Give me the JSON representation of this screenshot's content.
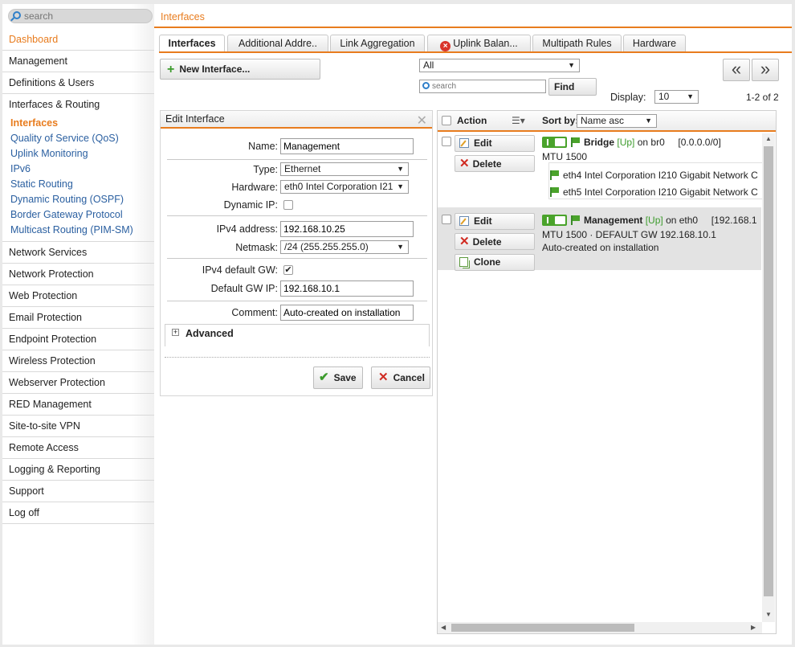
{
  "sidebar": {
    "search_placeholder": "search",
    "items_top": [
      {
        "label": "Dashboard",
        "active": true
      },
      {
        "label": "Management"
      },
      {
        "label": "Definitions & Users"
      }
    ],
    "open_section": "Interfaces & Routing",
    "subitems": [
      {
        "label": "Interfaces",
        "active": true
      },
      {
        "label": "Quality of Service (QoS)"
      },
      {
        "label": "Uplink Monitoring"
      },
      {
        "label": "IPv6"
      },
      {
        "label": "Static Routing"
      },
      {
        "label": "Dynamic Routing (OSPF)"
      },
      {
        "label": "Border Gateway Protocol"
      },
      {
        "label": "Multicast Routing (PIM-SM)"
      }
    ],
    "items_bottom": [
      {
        "label": "Network Services"
      },
      {
        "label": "Network Protection"
      },
      {
        "label": "Web Protection"
      },
      {
        "label": "Email Protection"
      },
      {
        "label": "Endpoint Protection"
      },
      {
        "label": "Wireless Protection"
      },
      {
        "label": "Webserver Protection"
      },
      {
        "label": "RED Management"
      },
      {
        "label": "Site-to-site VPN"
      },
      {
        "label": "Remote Access"
      },
      {
        "label": "Logging & Reporting"
      },
      {
        "label": "Support"
      },
      {
        "label": "Log off"
      }
    ]
  },
  "breadcrumb": "Interfaces",
  "tabs": [
    {
      "label": "Interfaces",
      "active": true
    },
    {
      "label": "Additional Addre.."
    },
    {
      "label": "Link Aggregation"
    },
    {
      "label": "Uplink Balan...",
      "error": true
    },
    {
      "label": "Multipath Rules"
    },
    {
      "label": "Hardware"
    }
  ],
  "toolbar": {
    "new_button": "New Interface...",
    "filter_value": "All",
    "search_placeholder": "search",
    "find_button": "Find",
    "prev_button": "«",
    "next_button": "»",
    "display_label": "Display:",
    "display_value": "10",
    "count": "1-2 of 2"
  },
  "edit_form": {
    "title": "Edit Interface",
    "name_label": "Name:",
    "name_value": "Management",
    "type_label": "Type:",
    "type_value": "Ethernet",
    "hardware_label": "Hardware:",
    "hardware_value": "eth0 Intel Corporation I21",
    "dynamic_ip_label": "Dynamic IP:",
    "dynamic_ip_checked": false,
    "ipv4_label": "IPv4 address:",
    "ipv4_value": "192.168.10.25",
    "netmask_label": "Netmask:",
    "netmask_value": "/24 (255.255.255.0)",
    "default_gw_label": "IPv4 default GW:",
    "default_gw_checked": true,
    "gw_ip_label": "Default GW IP:",
    "gw_ip_value": "192.168.10.1",
    "comment_label": "Comment:",
    "comment_value": "Auto-created on installation",
    "advanced_label": "Advanced",
    "save_button": "Save",
    "cancel_button": "Cancel"
  },
  "list": {
    "action_header": "Action",
    "sort_label": "Sort by:",
    "sort_value": "Name asc",
    "rows": [
      {
        "buttons": [
          "Edit",
          "Delete"
        ],
        "name": "Bridge",
        "status": "[Up]",
        "on": "on br0",
        "addr": "[0.0.0.0/0]",
        "line2": "MTU 1500",
        "members": [
          "eth4 Intel Corporation I210 Gigabit Network C",
          "eth5 Intel Corporation I210 Gigabit Network C"
        ]
      },
      {
        "buttons": [
          "Edit",
          "Delete",
          "Clone"
        ],
        "name": "Management",
        "status": "[Up]",
        "on": "on eth0",
        "addr": "[192.168.1",
        "line2": "MTU 1500 · DEFAULT GW 192.168.10.1",
        "line3": "Auto-created on installation"
      }
    ]
  },
  "colors": {
    "accent": "#e87c1e",
    "link": "#2a5fa0",
    "up": "#3c9b2c"
  }
}
